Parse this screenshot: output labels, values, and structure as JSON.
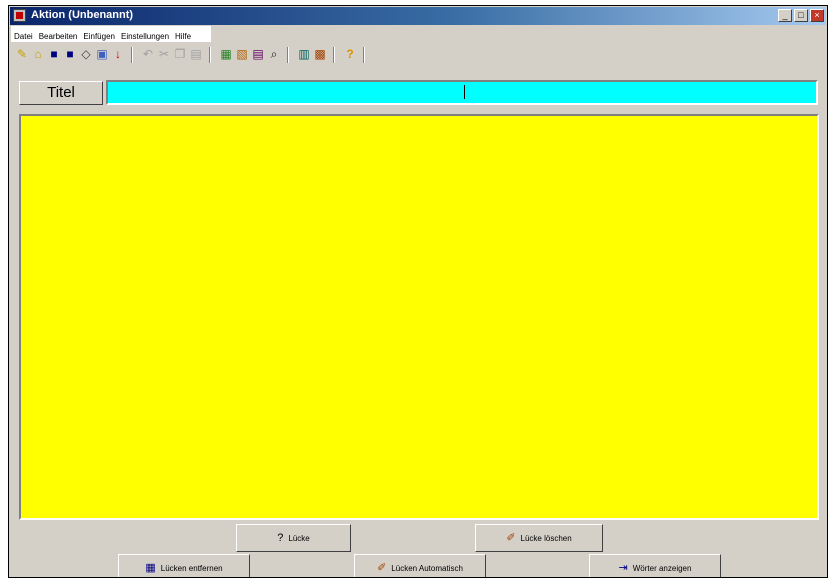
{
  "window": {
    "title": "Aktion (Unbenannt)"
  },
  "titlebar_buttons": [
    "_",
    "□",
    "×"
  ],
  "menu": [
    "Datei",
    "Bearbeiten",
    "Einfügen",
    "Einstellungen",
    "Hilfe"
  ],
  "toolbar_icons": [
    "new-icon",
    "open-icon",
    "save-icon",
    "save-as-icon",
    "eraser-icon",
    "print-icon",
    "marker-icon",
    "undo-icon",
    "cut-icon",
    "copy-icon",
    "paste-icon",
    "worksheet-icon",
    "solution-icon",
    "text-icon",
    "search-icon",
    "preview-icon",
    "color-icon",
    "help-icon"
  ],
  "title_field": {
    "label": "Titel",
    "value": ""
  },
  "buttons": {
    "luecke": {
      "label": "Lücke",
      "icon": "?"
    },
    "luecke_loeschen": {
      "label": "Lücke löschen",
      "icon": "✐"
    },
    "luecken_entfernen": {
      "label": "Lücken entfernen",
      "icon": "▦"
    },
    "luecken_automatisch": {
      "label": "Lücken Automatisch",
      "icon": "✐"
    },
    "woerter_anzeigen": {
      "label": "Wörter anzeigen",
      "icon": "⇥"
    }
  },
  "colors": {
    "title_field_bg": "#00ffff",
    "text_area_bg": "#ffff00",
    "window_bg": "#d4d0c8"
  }
}
